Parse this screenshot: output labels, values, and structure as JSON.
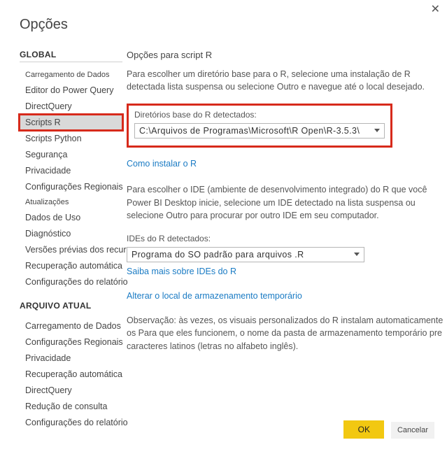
{
  "title": "Opções",
  "close_glyph": "✕",
  "sidebar": {
    "global_header": "GLOBAL",
    "global_items": [
      "Carregamento de Dados",
      "Editor do Power Query",
      "DirectQuery",
      "Scripts R",
      "Scripts Python",
      "Segurança",
      "Privacidade",
      "Configurações Regionais",
      "Atualizações",
      "Dados de Uso",
      "Diagnóstico",
      "Versões prévias dos recursos",
      "Recuperação automática",
      "Configurações do relatório"
    ],
    "current_header": "ARQUIVO ATUAL",
    "current_items": [
      "Carregamento de Dados",
      "Configurações Regionais",
      "Privacidade",
      "Recuperação automática",
      "DirectQuery",
      "Redução de consulta",
      "Configurações do relatório"
    ]
  },
  "main": {
    "heading": "Opções para script R",
    "intro": "Para escolher um diretório base para o R, selecione uma instalação de R detectada lista suspensa ou selecione Outro e navegue até o local desejado.",
    "r_dirs_label": "Diretórios base do R detectados:",
    "r_dirs_value": "C:\\Arquivos de Programas\\Microsoft\\R Open\\R-3.5.3\\",
    "install_link": "Como instalar o R",
    "ide_intro": "Para escolher o IDE (ambiente de desenvolvimento integrado) do R que você Power BI Desktop inicie, selecione um IDE detectado na lista suspensa ou selecione Outro para procurar por outro IDE em seu computador.",
    "ide_label": "IDEs do R detectados:",
    "ide_value": "Programa do SO padrão para arquivos .R",
    "ide_link": "Saiba mais sobre IDEs do R",
    "temp_link": "Alterar o local de armazenamento temporário",
    "temp_note": "Observação: às vezes, os visuais personalizados do R instalam automaticamente os Para que eles funcionem, o nome da pasta de armazenamento temporário pre caracteres latinos (letras no alfabeto inglês)."
  },
  "footer": {
    "ok": "OK",
    "cancel": "Cancelar"
  }
}
